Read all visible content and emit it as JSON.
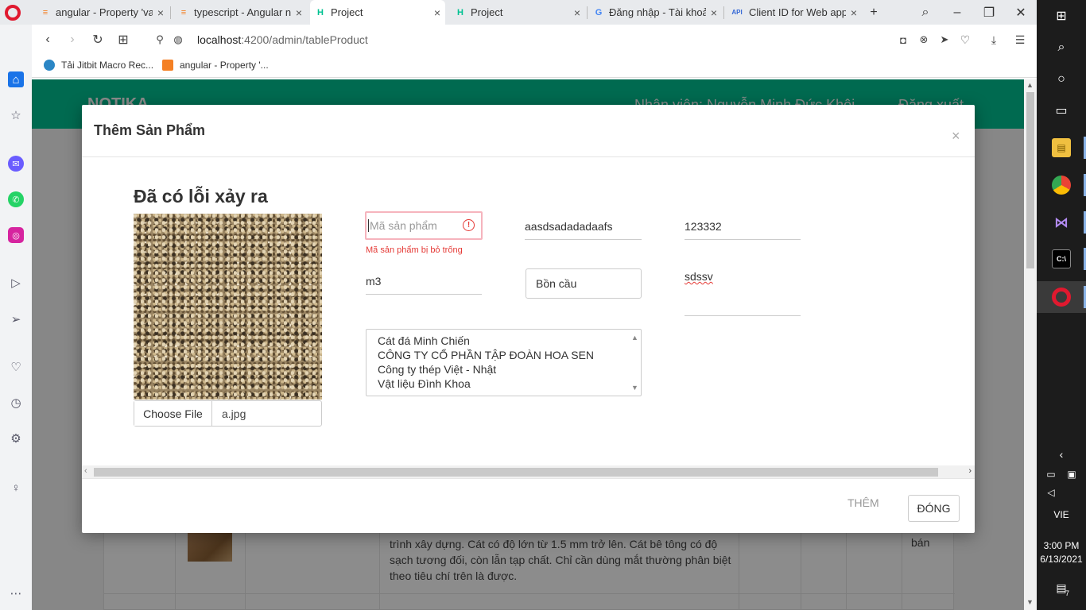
{
  "browser": {
    "tabs": [
      {
        "label": "angular - Property 'val",
        "favicon": "stackoverflow-icon",
        "active": false
      },
      {
        "label": "typescript - Angular nc",
        "favicon": "stackoverflow-icon",
        "active": false
      },
      {
        "label": "Project",
        "favicon": "notika-h-icon",
        "active": true
      },
      {
        "label": "Project",
        "favicon": "notika-h-icon",
        "active": false
      },
      {
        "label": "Đăng nhập - Tài khoản",
        "favicon": "google-g-icon",
        "active": false
      },
      {
        "label": "Client ID for Web appl",
        "favicon": "api-icon",
        "active": false
      }
    ],
    "api_badge": "API",
    "url_host": "localhost",
    "url_path": ":4200/admin/tableProduct",
    "bookmarks": [
      {
        "label": "Tải Jitbit Macro Rec..."
      },
      {
        "label": "angular - Property '..."
      }
    ]
  },
  "page": {
    "brand": "NOTIKA",
    "staff_label": "Nhân viên: Nguyễn Minh Đức Khôi",
    "logout_label": "Đăng xuất",
    "background_row": {
      "description": "trình xây dựng. Cát có độ lớn từ 1.5 mm trở lên. Cát bê tông có độ sạch tương đối, còn lẫn tạp chất. Chỉ cần dùng mắt thường phân biệt theo tiêu chí trên là được.",
      "status": "bán"
    }
  },
  "modal": {
    "title": "Thêm Sản Phẩm",
    "close_symbol": "×",
    "error_heading": "Đã có lỗi xảy ra",
    "file_button": "Choose File",
    "file_name": "a.jpg",
    "fields": {
      "code_placeholder": "Mã sản phẩm",
      "code_error": "Mã sản phẩm bị bỏ trống",
      "name_value": "aasdsadadadaafs",
      "price_value": "123332",
      "unit_value": "m3",
      "category_value": "Bồn cầu",
      "description_value": "sdssv"
    },
    "suppliers": [
      "Cát đá Minh Chiến",
      "CÔNG TY CỔ PHẦN TẬP ĐOÀN HOA SEN",
      "Công ty thép Việt - Nhật",
      "Vật liệu Đình Khoa"
    ],
    "add_button": "THÊM",
    "close_button": "ĐÓNG"
  },
  "taskbar": {
    "language": "VIE",
    "time": "3:00 PM",
    "date": "6/13/2021",
    "notification_count": "7"
  }
}
